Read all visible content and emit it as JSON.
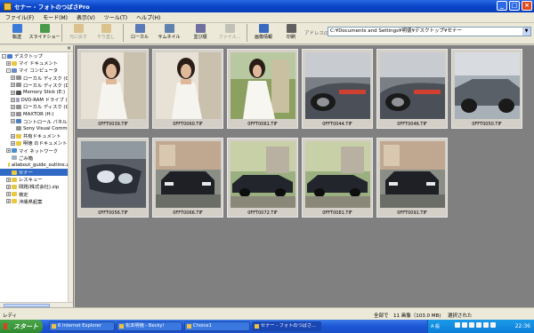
{
  "window": {
    "title": "セナー - フォトのつばさPro",
    "buttons": [
      "_",
      "□",
      "×"
    ]
  },
  "menu": [
    "ファイル(F)",
    "モード(M)",
    "表示(V)",
    "ツール(T)",
    "ヘルプ(H)"
  ],
  "toolbar": [
    {
      "label": "転送",
      "icon": "transfer-icon",
      "color": "#3a7ad8",
      "disabled": false
    },
    {
      "label": "スライドショー",
      "icon": "slideshow-icon",
      "color": "#4a9a4a",
      "disabled": false
    },
    {
      "label": "元に戻す",
      "icon": "undo-icon",
      "color": "#c89030",
      "disabled": true
    },
    {
      "label": "やり直し",
      "icon": "redo-icon",
      "color": "#c89030",
      "disabled": true
    },
    {
      "label": "ローカル",
      "icon": "local-icon",
      "color": "#5a7ab8",
      "disabled": false
    },
    {
      "label": "サムネイル",
      "icon": "thumbnail-icon",
      "color": "#6080b0",
      "disabled": false
    },
    {
      "label": "並び順",
      "icon": "sort-icon",
      "color": "#7070a0",
      "disabled": false
    },
    {
      "label": "ファイル...",
      "icon": "file-icon",
      "color": "#909090",
      "disabled": true
    },
    {
      "label": "画像情報",
      "icon": "info-icon",
      "color": "#3a6ac0",
      "disabled": false
    },
    {
      "label": "印刷",
      "icon": "print-icon",
      "color": "#606060",
      "disabled": false
    }
  ],
  "address": {
    "label": "アドレス(D)",
    "value": "C:¥Documents and Settings¥明徳¥デスクトップ¥セナー"
  },
  "tree": [
    {
      "indent": 0,
      "exp": "-",
      "label": "デスクトップ",
      "color": "#4a7ad0",
      "sel": false
    },
    {
      "indent": 1,
      "exp": "+",
      "label": "マイ ドキュメント",
      "color": "#e8c840",
      "sel": false
    },
    {
      "indent": 1,
      "exp": "-",
      "label": "マイ コンピュータ",
      "color": "#6a8ac8",
      "sel": false
    },
    {
      "indent": 2,
      "exp": "+",
      "label": "ローカル ディスク (C:)",
      "color": "#909090",
      "sel": false
    },
    {
      "indent": 2,
      "exp": "+",
      "label": "ローカル ディスク (D:)",
      "color": "#909090",
      "sel": false
    },
    {
      "indent": 2,
      "exp": "+",
      "label": "Memory Stick (E:)",
      "color": "#505050",
      "sel": false
    },
    {
      "indent": 2,
      "exp": "+",
      "label": "DVD-RAM ドライブ (F:)",
      "color": "#a0a0c0",
      "sel": false
    },
    {
      "indent": 2,
      "exp": "+",
      "label": "ローカル ディスク (G:)",
      "color": "#909090",
      "sel": false
    },
    {
      "indent": 2,
      "exp": "+",
      "label": "MAXTOR (H:)",
      "color": "#909090",
      "sel": false
    },
    {
      "indent": 2,
      "exp": "+",
      "label": "コントロール パネル",
      "color": "#5080c0",
      "sel": false
    },
    {
      "indent": 2,
      "exp": "",
      "label": "Sony Visual Commu",
      "color": "#909090",
      "sel": false
    },
    {
      "indent": 2,
      "exp": "+",
      "label": "共有ドキュメント",
      "color": "#e8c840",
      "sel": false
    },
    {
      "indent": 2,
      "exp": "+",
      "label": "明徳 のドキュメント",
      "color": "#e8c840",
      "sel": false
    },
    {
      "indent": 1,
      "exp": "+",
      "label": "マイ ネットワーク",
      "color": "#4a90d0",
      "sel": false
    },
    {
      "indent": 1,
      "exp": "",
      "label": "ごみ箱",
      "color": "#a0b0c0",
      "sel": false
    },
    {
      "indent": 1,
      "exp": "",
      "label": "allabout_guide_outline.zip",
      "color": "#e8c840",
      "sel": false
    },
    {
      "indent": 1,
      "exp": "",
      "label": "セナー",
      "color": "#e8c840",
      "sel": true
    },
    {
      "indent": 1,
      "exp": "+",
      "label": "レスキュー",
      "color": "#e8c840",
      "sel": false
    },
    {
      "indent": 1,
      "exp": "+",
      "label": "問題(株式会社).zip",
      "color": "#e8c840",
      "sel": false
    },
    {
      "indent": 1,
      "exp": "+",
      "label": "検定",
      "color": "#e8c840",
      "sel": false
    },
    {
      "indent": 1,
      "exp": "+",
      "label": "沖縄県起案",
      "color": "#e8c840",
      "sel": false
    }
  ],
  "thumbnails": [
    {
      "name": "0FFT0039.TIF",
      "kind": "portrait-white"
    },
    {
      "name": "0FFT0060.TIF",
      "kind": "portrait-white"
    },
    {
      "name": "0FFT0061.TIF",
      "kind": "portrait-outdoor"
    },
    {
      "name": "0FFT0044.TIF",
      "kind": "car-detail"
    },
    {
      "name": "0FFT0046.TIF",
      "kind": "car-detail"
    },
    {
      "name": "0FFT0050.TIF",
      "kind": "car-side"
    },
    {
      "name": "0FFT0056.TIF",
      "kind": "car-headlight"
    },
    {
      "name": "0FFT0066.TIF",
      "kind": "car-front"
    },
    {
      "name": "0FFT0072.TIF",
      "kind": "car-sedan"
    },
    {
      "name": "0FFT0081.TIF",
      "kind": "car-sedan"
    },
    {
      "name": "0FFT0091.TIF",
      "kind": "car-front"
    }
  ],
  "status": {
    "left": "レディ",
    "count": "全部で　11 画像（103.0 MB)",
    "selected": "選択された"
  },
  "taskbar": {
    "start": "スタート",
    "tasks": [
      {
        "label": "6 Internet Explorer",
        "active": false
      },
      {
        "label": "松本明徳 - Becky!",
        "active": false
      },
      {
        "label": "Choice1",
        "active": false
      },
      {
        "label": "セナー - フォトのつばさ...",
        "active": true
      }
    ],
    "lang": "A 般",
    "clock": "22:36"
  }
}
